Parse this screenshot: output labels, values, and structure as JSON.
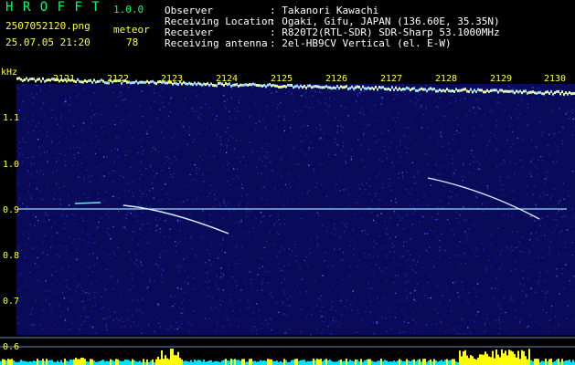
{
  "app": {
    "logo": "H R O F F T",
    "version": "1.0.0",
    "filename": "2507052120.png",
    "datetime": "25.07.05 21:20",
    "meteor_label": "meteor",
    "meteor_count": "78"
  },
  "info": {
    "observer_label": "Observer",
    "observer_value": ": Takanori Kawachi",
    "location_label": "Receiving Location",
    "location_value": ": Ogaki, Gifu, JAPAN (136.60E, 35.35N)",
    "receiver_label": "Receiver",
    "receiver_value": ": R820T2(RTL-SDR) SDR-Sharp 53.1000MHz",
    "antenna_label": "Receiving antenna",
    "antenna_value": ": 2el-HB9CV Vertical (el. E-W)"
  },
  "axis": {
    "y_unit": "kHz",
    "y_ticks": [
      "1.1",
      "1.0",
      "0.9",
      "0.8",
      "0.7",
      "0.6"
    ],
    "x_ticks": [
      "2121",
      "2122",
      "2123",
      "2124",
      "2125",
      "2126",
      "2127",
      "2128",
      "2129",
      "2130"
    ]
  },
  "colors": {
    "background": "#000000",
    "plot_noise": "#0a0a5a",
    "label": "#ffff33",
    "title": "#00ff66",
    "carrier": "#9fd8ff",
    "meteor": "#cfe9ff"
  },
  "chart_data": {
    "type": "heatmap",
    "xlabel": "",
    "ylabel": "kHz",
    "x_categories": [
      "2121",
      "2122",
      "2123",
      "2124",
      "2125",
      "2126",
      "2127",
      "2128",
      "2129",
      "2130"
    ],
    "y_range_khz": [
      0.58,
      1.18
    ],
    "carrier_khz": 0.9,
    "meteor_echoes": [
      {
        "time_label": "2122-2123",
        "freq_start_khz": 0.91,
        "freq_end_khz": 0.86
      },
      {
        "time_label": "2128-2129",
        "freq_start_khz": 0.97,
        "freq_end_khz": 0.88
      }
    ]
  }
}
